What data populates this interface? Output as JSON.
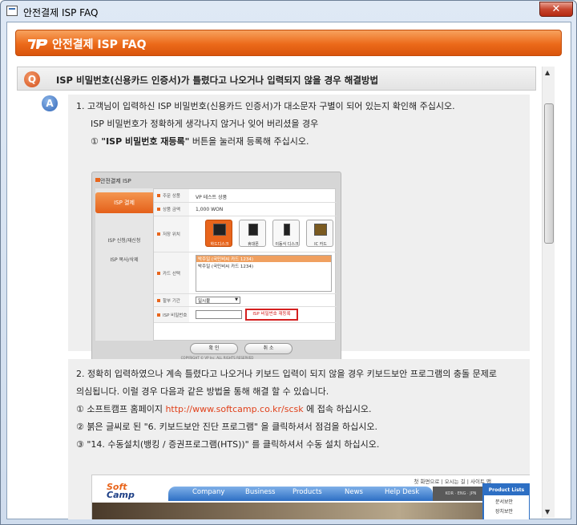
{
  "window": {
    "title": "안전결제 ISP FAQ",
    "close_glyph": "✕"
  },
  "header": {
    "title": "안전결제 ISP FAQ"
  },
  "question": {
    "icon": "Q",
    "text": "ISP 비밀번호(신용카드 인증서)가 틀렸다고 나오거나 입력되지 않을 경우 해결방법"
  },
  "answer_icon": "A",
  "answer1": {
    "line1": "1. 고객님이 입력하신 ISP 비밀번호(신용카드 인증서)가 대소문자 구별이 되어 있는지 확인해 주십시오.",
    "line2": "ISP 비밀번호가 정확하게 생각나지 않거나 잊어 버리셨을 경우",
    "line3_prefix": "① ",
    "line3_bold": "\"ISP 비밀번호 재등록\"",
    "line3_rest": " 버튼을 눌러재 등록해 주십시오."
  },
  "isp_window": {
    "title": "안전결제 ISP",
    "active_tab": "ISP 결제",
    "menu": [
      "ISP 신청/재신청",
      "ISP 복사/삭제"
    ],
    "rows": {
      "product_label": "주문 상품",
      "product_value": "VP 테스트 상품",
      "amount_label": "상품 금액",
      "amount_value": "1,000 WON",
      "storage_label": "저장 위치",
      "devices": [
        "하드디스크",
        "휴대폰",
        "이동식 디스크",
        "IC 카드"
      ],
      "card_label": "카드 선택",
      "cards": [
        "박주일 (국민비씨 카드 1234)",
        "박주일 (국민비씨 카드 1234)"
      ],
      "installment_label": "할부 기간",
      "installment_value": "일시불",
      "password_label": "ISP 비밀번호",
      "reregister_button": "ISP 비밀번호 재등록"
    },
    "confirm_button": "확 인",
    "cancel_button": "취 소",
    "copyright": "COPYRIGHT © VP Inc. ALL RIGHTS RESERVED"
  },
  "answer2": {
    "line1": "2. 정확히 입력하였으나 계속 틀렸다고 나오거나 키보드 입력이 되지 않을 경우 키보드보안 프로그램의 충돌 문제로",
    "line2": "의심됩니다. 이럴 경우 다음과 같은 방법을 통해 해결 할 수 있습니다.",
    "line3_prefix": "① 소프트캠프 홈페이지 ",
    "line3_link": "http://www.softcamp.co.kr/scsk",
    "line3_rest": " 에 접속 하십시오.",
    "line4": "② 붉은 글씨로 된 \"6. 키보드보안 진단 프로그램\" 을 클릭하셔서 점검을 하십시오.",
    "line5": "③ \"14. 수동설치(뱅킹 / 증권프로그램(HTS))\" 를 클릭하셔서 수동 설치 하십시오."
  },
  "softcamp": {
    "top_links": "첫 화면으로 | 오시는 길 | 사이트 맵",
    "logo_top": "Soft",
    "logo_bottom": "Camp",
    "nav": [
      "Company",
      "Business",
      "Products",
      "News",
      "Help Desk"
    ],
    "lang": "KOR · ENG · JPN",
    "product_lists_title": "Product Lists",
    "product_items": [
      "문서보안",
      "장치보안"
    ]
  }
}
